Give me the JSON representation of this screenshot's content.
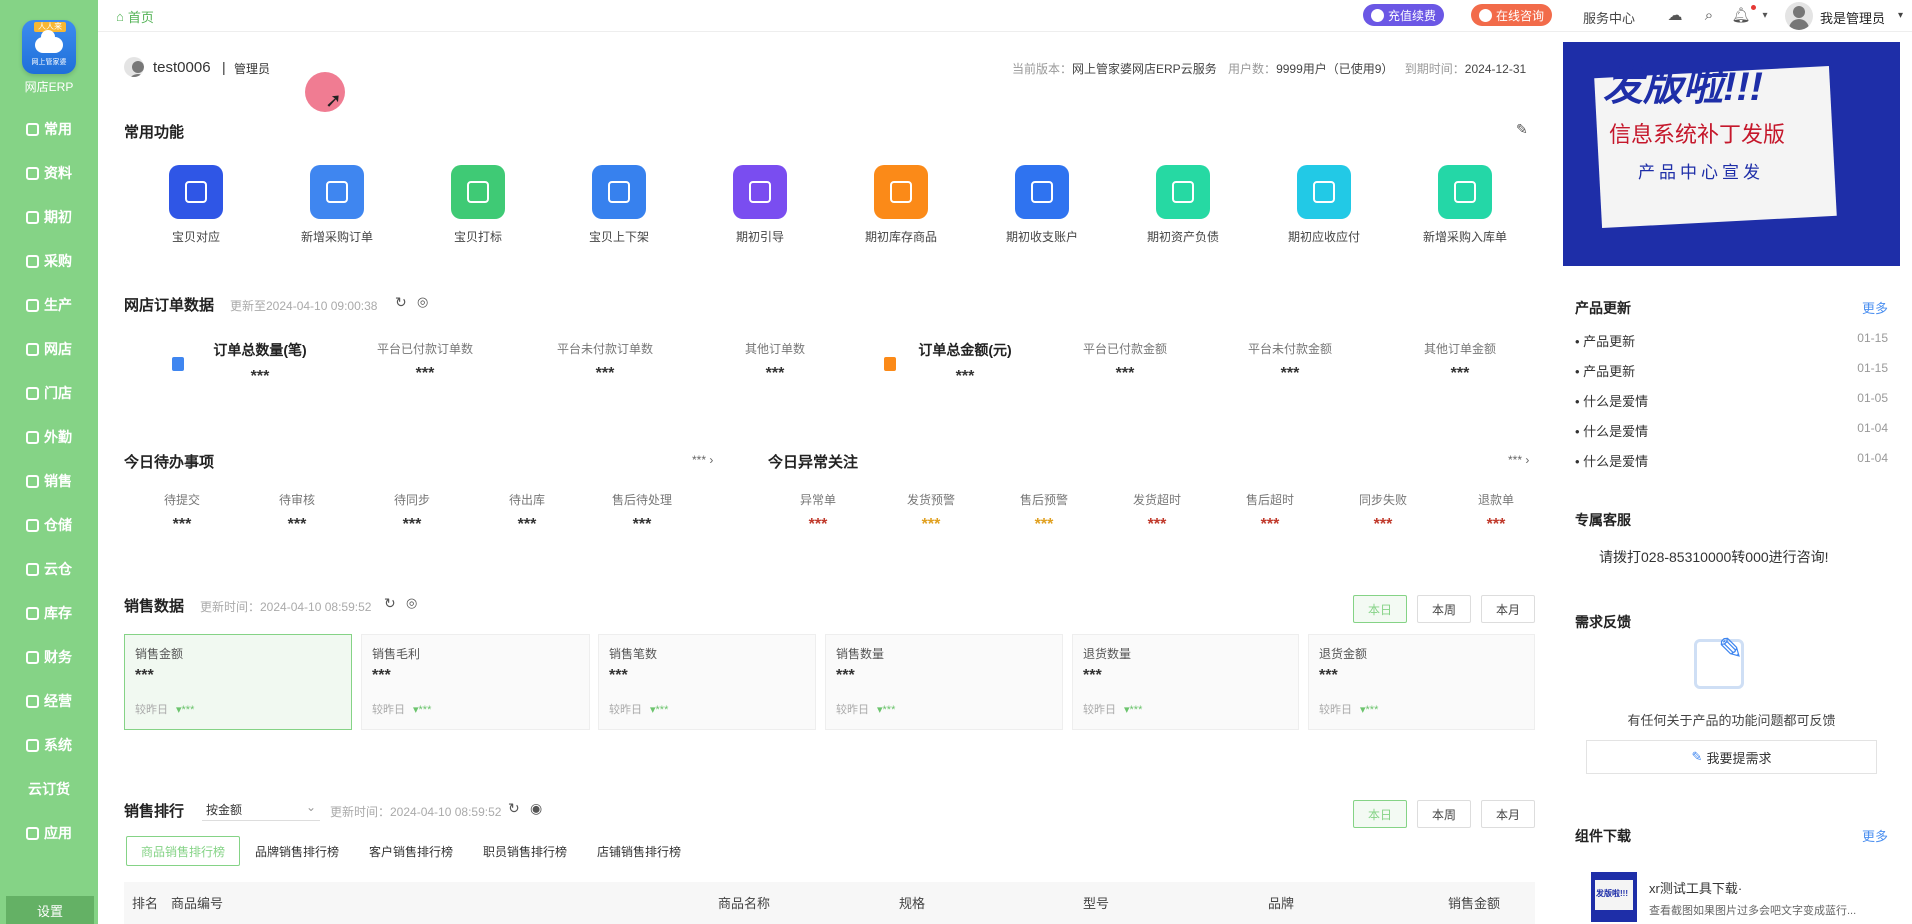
{
  "sidebar": {
    "logo_ribbon": "人人来",
    "logo_text": "网上管家婆",
    "app_name": "网店ERP",
    "items": [
      {
        "label": "常用"
      },
      {
        "label": "资料"
      },
      {
        "label": "期初"
      },
      {
        "label": "采购"
      },
      {
        "label": "生产"
      },
      {
        "label": "网店"
      },
      {
        "label": "门店"
      },
      {
        "label": "外勤"
      },
      {
        "label": "销售"
      },
      {
        "label": "仓储"
      },
      {
        "label": "云仓"
      },
      {
        "label": "库存"
      },
      {
        "label": "财务"
      },
      {
        "label": "经营"
      },
      {
        "label": "系统"
      },
      {
        "label": "云订货"
      },
      {
        "label": "应用"
      }
    ],
    "settings": "设置"
  },
  "topbar": {
    "home": "首页",
    "recharge": "充值续费",
    "consult": "在线咨询",
    "service": "服务中心",
    "user": "我是管理员"
  },
  "account": {
    "name": "test0006",
    "sep": "|",
    "role": "管理员",
    "version_label": "当前版本：",
    "version": "网上管家婆网店ERP云服务",
    "users_label": "用户数：",
    "users": "9999用户（已使用9）",
    "expire_label": "到期时间：",
    "expire": "2024-12-31"
  },
  "common": {
    "title": "常用功能",
    "items": [
      {
        "label": "宝贝对应",
        "color": "#2f56e6"
      },
      {
        "label": "新增采购订单",
        "color": "#3f86f0"
      },
      {
        "label": "宝贝打标",
        "color": "#3fca75"
      },
      {
        "label": "宝贝上下架",
        "color": "#3781ee"
      },
      {
        "label": "期初引导",
        "color": "#7a4df0"
      },
      {
        "label": "期初库存商品",
        "color": "#fb8a18"
      },
      {
        "label": "期初收支账户",
        "color": "#2f73f0"
      },
      {
        "label": "期初资产负债",
        "color": "#26d9a3"
      },
      {
        "label": "期初应收应付",
        "color": "#22c9e6"
      },
      {
        "label": "新增采购入库单",
        "color": "#24d7a7"
      }
    ]
  },
  "orders": {
    "title": "网店订单数据",
    "updated": "更新至2024-04-10 09:00:38",
    "stats": [
      {
        "label": "订单总数量(笔)",
        "value": "***"
      },
      {
        "label": "平台已付款订单数",
        "value": "***"
      },
      {
        "label": "平台未付款订单数",
        "value": "***"
      },
      {
        "label": "其他订单数",
        "value": "***"
      },
      {
        "label": "订单总金额(元)",
        "value": "***"
      },
      {
        "label": "平台已付款金额",
        "value": "***"
      },
      {
        "label": "平台未付款金额",
        "value": "***"
      },
      {
        "label": "其他订单金额",
        "value": "***"
      }
    ]
  },
  "todo": {
    "title": "今日待办事项",
    "more": "***",
    "items": [
      {
        "label": "待提交",
        "value": "***"
      },
      {
        "label": "待审核",
        "value": "***"
      },
      {
        "label": "待同步",
        "value": "***"
      },
      {
        "label": "待出库",
        "value": "***"
      },
      {
        "label": "售后待处理",
        "value": "***"
      }
    ]
  },
  "abnormal": {
    "title": "今日异常关注",
    "more": "***",
    "items": [
      {
        "label": "异常单",
        "value": "***",
        "color": "#c0392b"
      },
      {
        "label": "发货预警",
        "value": "***",
        "color": "#e0a020"
      },
      {
        "label": "售后预警",
        "value": "***",
        "color": "#e0a020"
      },
      {
        "label": "发货超时",
        "value": "***",
        "color": "#c0392b"
      },
      {
        "label": "售后超时",
        "value": "***",
        "color": "#c0392b"
      },
      {
        "label": "同步失败",
        "value": "***",
        "color": "#c0392b"
      },
      {
        "label": "退款单",
        "value": "***",
        "color": "#c0392b"
      }
    ]
  },
  "sales": {
    "title": "销售数据",
    "updated": "更新时间：2024-04-10 08:59:52",
    "btn_day": "本日",
    "btn_week": "本周",
    "btn_month": "本月",
    "cards": [
      {
        "title": "销售金额",
        "value": "***",
        "compare": "较昨日",
        "delta": "▾***"
      },
      {
        "title": "销售毛利",
        "value": "***",
        "compare": "较昨日",
        "delta": "▾***"
      },
      {
        "title": "销售笔数",
        "value": "***",
        "compare": "较昨日",
        "delta": "▾***"
      },
      {
        "title": "销售数量",
        "value": "***",
        "compare": "较昨日",
        "delta": "▾***"
      },
      {
        "title": "退货数量",
        "value": "***",
        "compare": "较昨日",
        "delta": "▾***"
      },
      {
        "title": "退货金额",
        "value": "***",
        "compare": "较昨日",
        "delta": "▾***"
      }
    ]
  },
  "ranking": {
    "title": "销售排行",
    "sort": "按金额",
    "updated": "更新时间：2024-04-10 08:59:52",
    "tabs": [
      "商品销售排行榜",
      "品牌销售排行榜",
      "客户销售排行榜",
      "职员销售排行榜",
      "店铺销售排行榜"
    ],
    "columns": [
      "排名",
      "商品编号",
      "商品名称",
      "规格",
      "型号",
      "品牌",
      "销售金额"
    ]
  },
  "banner": {
    "headline": "发版啦!!!",
    "sub": "信息系统补丁发版",
    "foot": "产品中心宣发"
  },
  "updates": {
    "title": "产品更新",
    "more": "更多",
    "items": [
      {
        "text": "• 产品更新",
        "date": "01-15"
      },
      {
        "text": "• 产品更新",
        "date": "01-15"
      },
      {
        "text": "• 什么是爱情",
        "date": "01-05"
      },
      {
        "text": "• 什么是爱情",
        "date": "01-04"
      },
      {
        "text": "• 什么是爱情",
        "date": "01-04"
      }
    ]
  },
  "support": {
    "title": "专属客服",
    "text": "请拨打028-85310000转000进行咨询!"
  },
  "feedback": {
    "title": "需求反馈",
    "text": "有任何关于产品的功能问题都可反馈",
    "button": "我要提需求"
  },
  "downloads": {
    "title": "组件下载",
    "more": "更多",
    "item_title": "xr测试工具下载·",
    "item_desc": "查看截图如果图片过多会吧文字变成蓝行...",
    "thumb": "发版啦!!!"
  }
}
